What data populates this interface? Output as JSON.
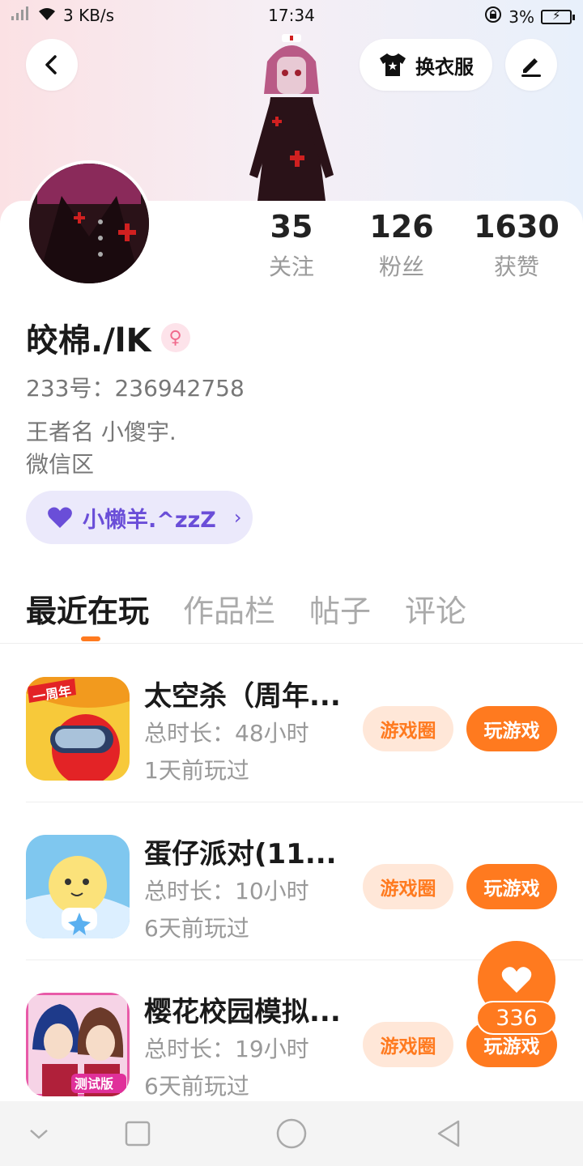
{
  "status_bar": {
    "network_speed": "3 KB/s",
    "time": "17:34",
    "battery": "3%"
  },
  "header": {
    "back_icon": "chevron-left-icon",
    "dress_label": "换衣服",
    "dress_icon": "shirt-icon",
    "edit_icon": "pen-icon"
  },
  "stats": [
    {
      "value": "35",
      "label": "关注"
    },
    {
      "value": "126",
      "label": "粉丝"
    },
    {
      "value": "1630",
      "label": "获赞"
    }
  ],
  "profile": {
    "name": "皎棉./lK",
    "gender_icon": "female-icon",
    "account_id": "233号：236942758",
    "bio_lines": [
      "王者名  小傻宇.",
      "微信区"
    ],
    "tag_label": "小懒羊.^zzZ",
    "tag_icon": "heart-icon"
  },
  "tabs": [
    "最近在玩",
    "作品栏",
    "帖子",
    "评论"
  ],
  "games": [
    {
      "title": "太空杀（周年...",
      "duration": "总时长：48小时",
      "last_played": "1天前玩过",
      "circle_label": "游戏圈",
      "play_label": "玩游戏"
    },
    {
      "title": "蛋仔派对(11...",
      "duration": "总时长：10小时",
      "last_played": "6天前玩过",
      "circle_label": "游戏圈",
      "play_label": "玩游戏"
    },
    {
      "title": "樱花校园模拟...",
      "duration": "总时长：19小时",
      "last_played": "6天前玩过",
      "circle_label": "游戏圈",
      "play_label": "玩游戏"
    }
  ],
  "game_icon_texts": [
    "一周年",
    "测试版"
  ],
  "like": {
    "count": "336",
    "icon": "heart-icon"
  },
  "colors": {
    "accent": "#ff7a1f",
    "tag": "#6a4ed8"
  }
}
